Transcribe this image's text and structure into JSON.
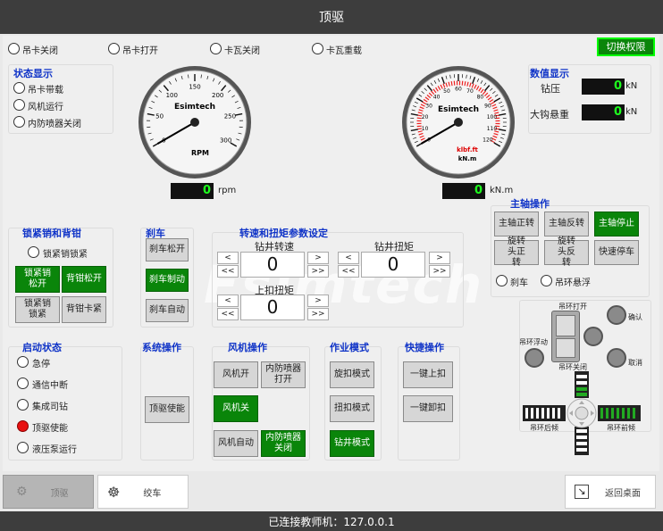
{
  "window": {
    "title": "顶驱"
  },
  "top_status": [
    {
      "label": "吊卡关闭"
    },
    {
      "label": "吊卡打开"
    },
    {
      "label": "卡瓦关闭"
    },
    {
      "label": "卡瓦重载"
    }
  ],
  "switch_perm_label": "切换权限",
  "state_display": {
    "title": "状态显示",
    "items": [
      "吊卡带载",
      "风机运行",
      "内防喷器关闭"
    ]
  },
  "rpm_gauge": {
    "brand": "Esimtech",
    "unit_label": "RPM",
    "ticks": [
      "0",
      "50",
      "100",
      "150",
      "200",
      "250",
      "300"
    ],
    "value": 0,
    "max": 300,
    "display_value": "0",
    "display_unit": "rpm"
  },
  "torque_gauge": {
    "brand": "Esimtech",
    "unit_line1": "klbf.ft",
    "unit_line2": "kN.m",
    "ticks": [
      "0",
      "10",
      "20",
      "30",
      "40",
      "50",
      "60",
      "70",
      "80",
      "90",
      "100",
      "110",
      "120"
    ],
    "value": 0,
    "max": 120,
    "display_value": "0",
    "display_unit": "kN.m"
  },
  "numeric_display": {
    "title": "数值显示",
    "rows": [
      {
        "label": "钻压",
        "value": "0",
        "unit": "kN"
      },
      {
        "label": "大钩悬重",
        "value": "0",
        "unit": "kN"
      }
    ]
  },
  "lock": {
    "title": "锁紧销和背钳",
    "status_label": "锁紧销锁紧",
    "buttons": [
      "锁紧销松开",
      "背钳松开",
      "锁紧销锁紧",
      "背钳卡紧"
    ]
  },
  "brake": {
    "title": "刹车",
    "buttons": [
      "刹车松开",
      "刹车制动",
      "刹车自动"
    ]
  },
  "params": {
    "title": "转速和扭矩参数设定",
    "drill_speed_label": "钻井转速",
    "drill_speed": "0",
    "drill_torque_label": "钻井扭矩",
    "drill_torque": "0",
    "makeup_torque_label": "上扣扭矩",
    "makeup_torque": "0",
    "dec": "<",
    "dec_fast": "<<",
    "inc": ">",
    "inc_fast": ">>"
  },
  "spindle": {
    "title": "主轴操作",
    "buttons": [
      "主轴正转",
      "主轴反转",
      "主轴停止",
      "旋转头正转",
      "旋转头反转",
      "快速停车"
    ],
    "status": [
      "刹车",
      "吊环悬浮"
    ]
  },
  "bail": {
    "open": "吊环打开",
    "float": "吊环浮动",
    "close": "吊环关闭",
    "confirm": "确认",
    "cancel": "取消",
    "back_tilt": "吊环后倾",
    "front_tilt": "吊环前倾"
  },
  "startup": {
    "title": "启动状态",
    "items": [
      "急停",
      "通信中断",
      "集成司钻",
      "顶驱使能",
      "液压泵运行"
    ]
  },
  "system": {
    "title": "系统操作",
    "button": "顶驱使能"
  },
  "fan": {
    "title": "风机操作",
    "buttons": [
      "风机开",
      "内防喷器打开",
      "风机关",
      "风机自动",
      "内防喷器关闭"
    ]
  },
  "mode": {
    "title": "作业模式",
    "buttons": [
      "旋扣模式",
      "扭扣模式",
      "钻井模式"
    ]
  },
  "quick": {
    "title": "快捷操作",
    "buttons": [
      "一键上扣",
      "一键卸扣"
    ]
  },
  "watermark": "Esimtech",
  "nav": {
    "topdrive": "顶驱",
    "drawworks": "绞车",
    "back": "返回桌面"
  },
  "footer": {
    "text": "已连接教师机：127.0.0.1"
  }
}
